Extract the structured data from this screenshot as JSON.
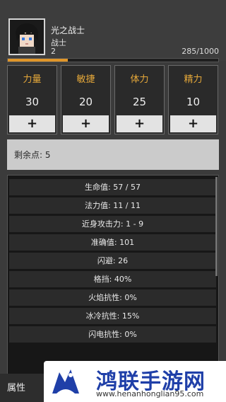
{
  "character": {
    "name": "光之战士",
    "class": "战士",
    "level": "2",
    "xp_text": "285/1000",
    "xp_fraction": 0.285
  },
  "attributes": [
    {
      "label": "力量",
      "value": "30",
      "button": "+"
    },
    {
      "label": "敏捷",
      "value": "20",
      "button": "+"
    },
    {
      "label": "体力",
      "value": "25",
      "button": "+"
    },
    {
      "label": "精力",
      "value": "10",
      "button": "+"
    }
  ],
  "remaining": {
    "text": "剩余点: 5"
  },
  "stats": [
    "生命值: 57 / 57",
    "法力值: 11 / 11",
    "近身攻击力: 1 - 9",
    "准确值: 101",
    "闪避: 26",
    "格挡: 40%",
    "火焰抗性: 0%",
    "冰冷抗性: 15%",
    "闪电抗性: 0%"
  ],
  "bottom_tab": {
    "label": "属性"
  },
  "watermark": {
    "title": "鸿联手游网",
    "url": "www.henanhonglian95.com"
  },
  "colors": {
    "accent_gold": "#e7a93a",
    "xp_bar": "#e0962a",
    "panel_bg": "#2a2a2a",
    "watermark_blue": "#1f3fa8"
  }
}
